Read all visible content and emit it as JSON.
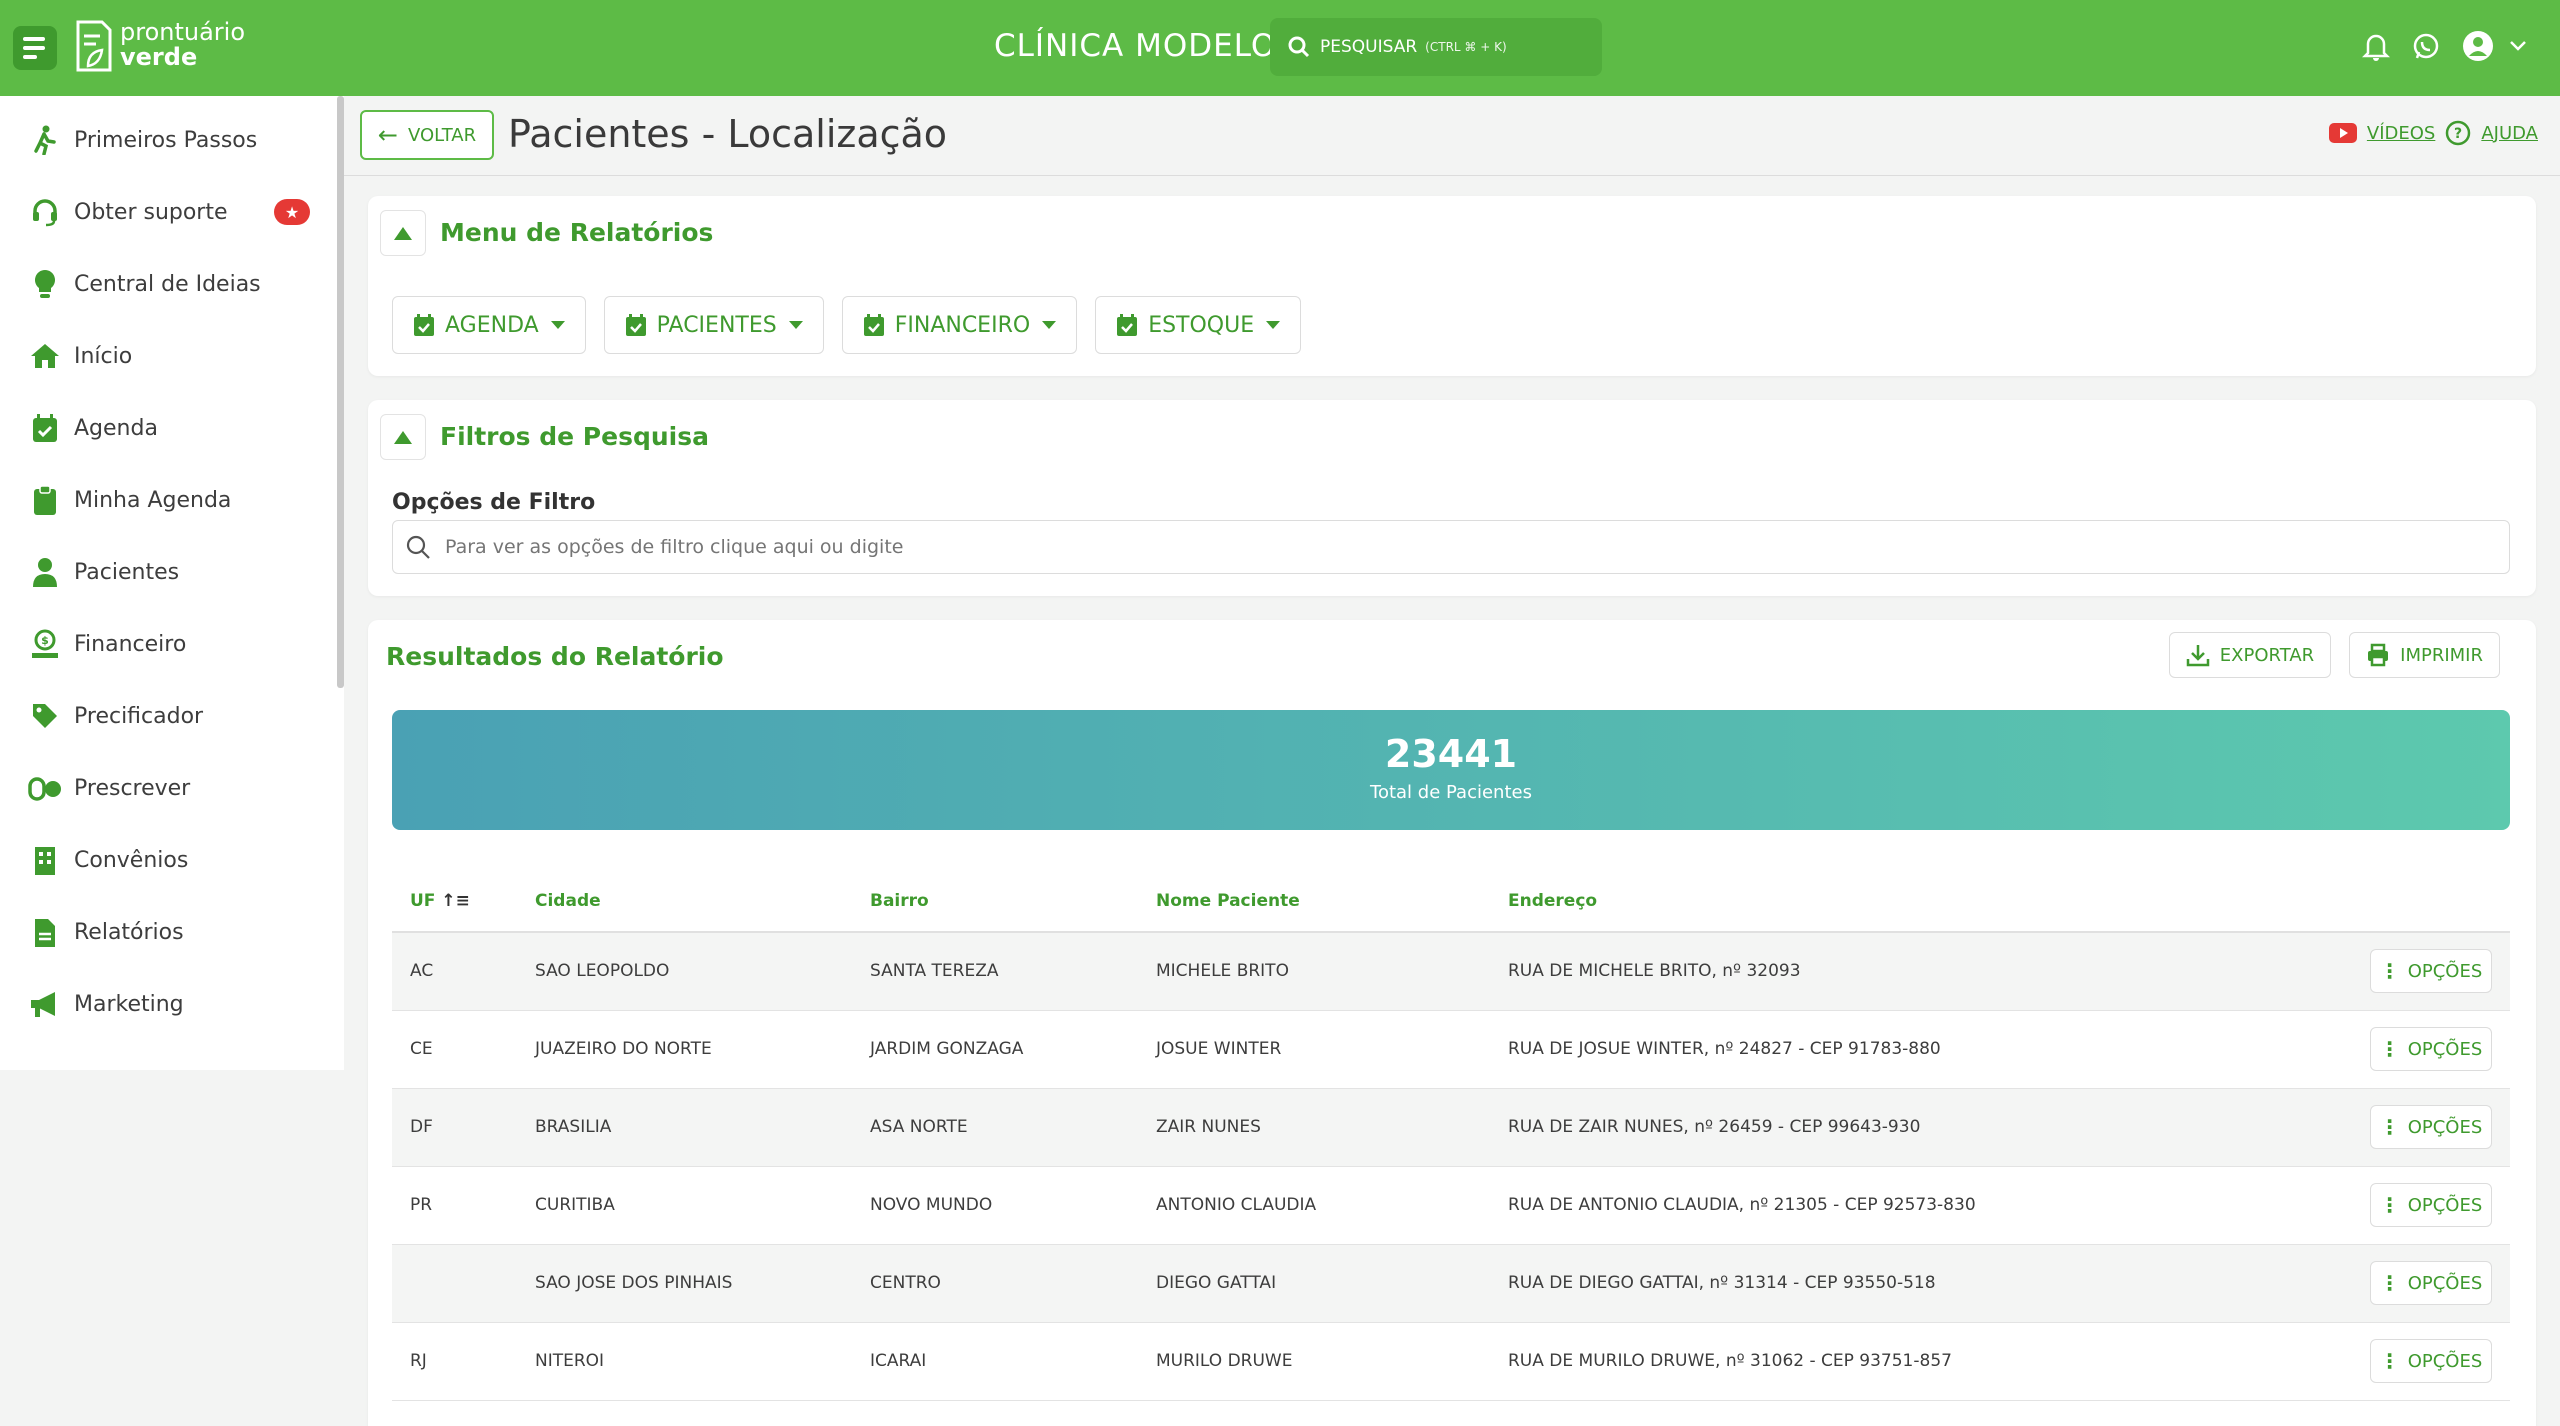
{
  "app": {
    "logo_line1": "prontuário",
    "logo_line2": "verde",
    "clinic_name": "CLÍNICA MODELO",
    "search_label": "PESQUISAR",
    "search_hint": "(CTRL ⌘ + K)"
  },
  "sidebar": {
    "items": [
      {
        "label": "Primeiros Passos",
        "icon": "walk-icon"
      },
      {
        "label": "Obter suporte",
        "icon": "headset-icon",
        "badge": "★"
      },
      {
        "label": "Central de Ideias",
        "icon": "lightbulb-icon"
      },
      {
        "label": "Início",
        "icon": "home-icon"
      },
      {
        "label": "Agenda",
        "icon": "calendar-check-icon"
      },
      {
        "label": "Minha Agenda",
        "icon": "clipboard-icon"
      },
      {
        "label": "Pacientes",
        "icon": "user-icon"
      },
      {
        "label": "Financeiro",
        "icon": "money-hand-icon"
      },
      {
        "label": "Precificador",
        "icon": "tag-icon"
      },
      {
        "label": "Prescrever",
        "icon": "pills-icon"
      },
      {
        "label": "Convênios",
        "icon": "building-icon"
      },
      {
        "label": "Relatórios",
        "icon": "report-icon"
      },
      {
        "label": "Marketing",
        "icon": "megaphone-icon"
      }
    ]
  },
  "header": {
    "back_label": "VOLTAR",
    "title": "Pacientes - Localização",
    "videos_label": "VÍDEOS",
    "help_label": "AJUDA"
  },
  "report_menu": {
    "title": "Menu de Relatórios",
    "buttons": [
      "AGENDA",
      "PACIENTES",
      "FINANCEIRO",
      "ESTOQUE"
    ]
  },
  "filters": {
    "title": "Filtros de Pesquisa",
    "label": "Opções de Filtro",
    "placeholder": "Para ver as opções de filtro clique aqui ou digite"
  },
  "results": {
    "title": "Resultados do Relatório",
    "export_label": "EXPORTAR",
    "print_label": "IMPRIMIR",
    "total_value": "23441",
    "total_label": "Total de Pacientes",
    "columns": [
      "UF",
      "Cidade",
      "Bairro",
      "Nome Paciente",
      "Endereço"
    ],
    "options_label": "OPÇÕES",
    "rows": [
      [
        "AC",
        "SAO LEOPOLDO",
        "SANTA TEREZA",
        "MICHELE BRITO",
        "RUA DE MICHELE BRITO, nº 32093"
      ],
      [
        "CE",
        "JUAZEIRO DO NORTE",
        "JARDIM GONZAGA",
        "JOSUE WINTER",
        "RUA DE JOSUE WINTER, nº 24827 - CEP 91783-880"
      ],
      [
        "DF",
        "BRASILIA",
        "ASA NORTE",
        "ZAIR NUNES",
        "RUA DE ZAIR NUNES, nº 26459 - CEP 99643-930"
      ],
      [
        "PR",
        "CURITIBA",
        "NOVO MUNDO",
        "ANTONIO CLAUDIA",
        "RUA DE ANTONIO CLAUDIA, nº 21305 - CEP 92573-830"
      ],
      [
        "",
        "SAO JOSE DOS PINHAIS",
        "CENTRO",
        "DIEGO GATTAI",
        "RUA DE DIEGO GATTAI, nº 31314 - CEP 93550-518"
      ],
      [
        "RJ",
        "NITEROI",
        "ICARAI",
        "MURILO DRUWE",
        "RUA DE MURILO DRUWE, nº 31062 - CEP 93751-857"
      ]
    ]
  },
  "colors": {
    "brand": "#5dbb46",
    "brand_dark": "#3f9a2e",
    "badge": "#e53935"
  }
}
